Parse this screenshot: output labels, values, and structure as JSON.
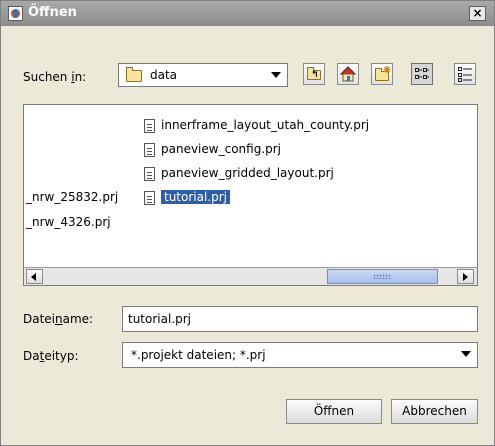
{
  "window": {
    "title": "Öffnen",
    "close_glyph": "×"
  },
  "lookin": {
    "label_pre": "Suchen ",
    "label_u": "i",
    "label_post": "n:",
    "value": "data"
  },
  "toolbar": {
    "icons": [
      "up-folder-icon",
      "home-icon",
      "new-folder-icon",
      "list-view-icon",
      "details-view-icon"
    ]
  },
  "files": [
    {
      "name": "innerframe_layout_utah_county.prj",
      "icon": true,
      "selected": false
    },
    {
      "name": "paneview_config.prj",
      "icon": true,
      "selected": false
    },
    {
      "name": "paneview_gridded_layout.prj",
      "icon": true,
      "selected": false
    },
    {
      "name": "_nrw_25832.prj",
      "icon": false,
      "selected": false
    },
    {
      "name": "tutorial.prj",
      "icon": true,
      "selected": true
    },
    {
      "name": "_nrw_4326.prj",
      "icon": false,
      "selected": false
    }
  ],
  "filename": {
    "label_pre": "Datei",
    "label_u": "n",
    "label_post": "ame:",
    "value": "tutorial.prj"
  },
  "filetype": {
    "label_pre": "Da",
    "label_u": "t",
    "label_post": "eityp:",
    "value": "*.projekt dateien; *.prj"
  },
  "buttons": {
    "open": "Öffnen",
    "cancel": "Abbrechen"
  },
  "colors": {
    "selection": "#2f5ea8",
    "titlebar": "#999999"
  }
}
